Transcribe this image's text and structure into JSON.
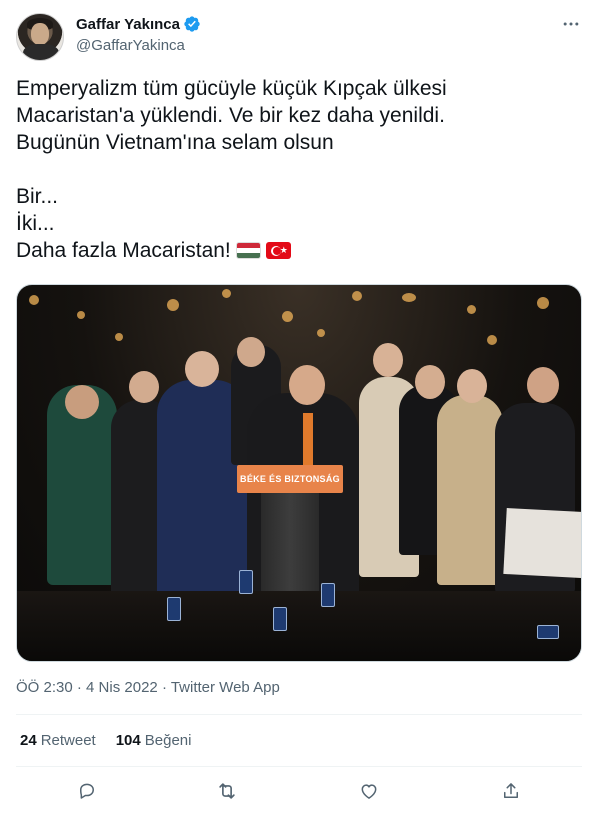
{
  "author": {
    "display_name": "Gaffar Yakınca",
    "handle": "@GaffarYakinca",
    "verified_icon": "verified-badge-icon",
    "verified_color": "#1d9bf0"
  },
  "tweet": {
    "lines": [
      "Emperyalizm tüm gücüyle küçük Kıpçak ülkesi",
      "Macaristan'a yüklendi. Ve bir kez daha yenildi.",
      "Bugünün Vietnam'ına selam olsun",
      "Bir...",
      "İki...",
      "Daha fazla Macaristan!"
    ],
    "flags": [
      "hungary-flag",
      "turkey-flag"
    ]
  },
  "media": {
    "sign_text": "BÉKE ÉS BIZTONSÁG"
  },
  "meta": {
    "time": "ÖÖ 2:30",
    "separator": "·",
    "date": "4 Nis 2022",
    "source": "Twitter Web App"
  },
  "stats": {
    "retweets_count": "24",
    "retweets_label": "Retweet",
    "likes_count": "104",
    "likes_label": "Beğeni"
  },
  "actions": [
    "reply-icon",
    "retweet-icon",
    "like-icon",
    "share-icon"
  ],
  "colors": {
    "text": "#0f1419",
    "secondary": "#536471",
    "divider": "#eff3f4",
    "accent": "#1d9bf0"
  }
}
